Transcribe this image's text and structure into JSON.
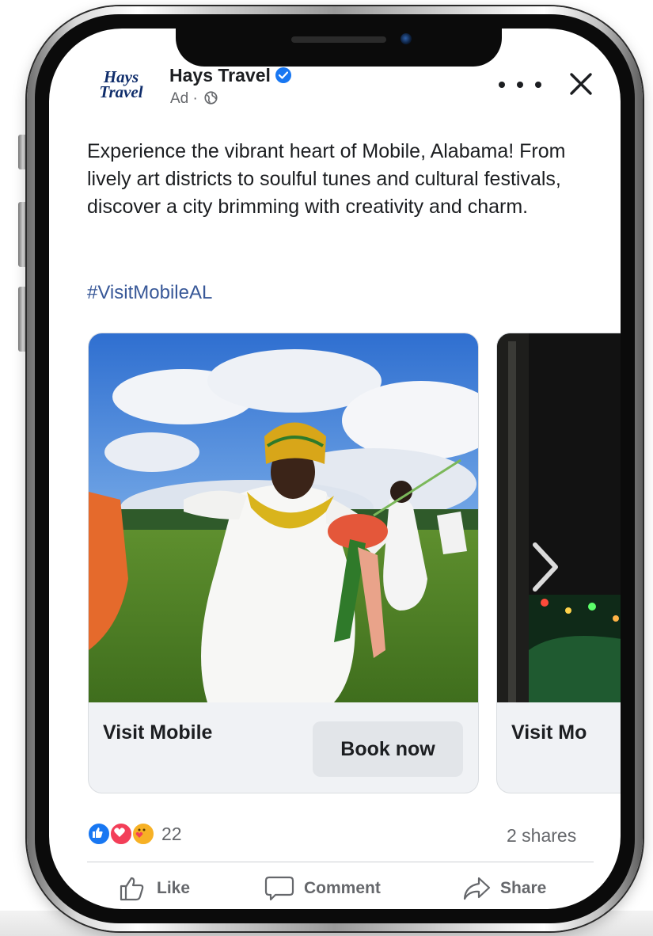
{
  "post": {
    "logo_line1": "Hays",
    "logo_line2": "Travel",
    "page_name": "Hays Travel",
    "sponsored_label": "Ad ·",
    "caption": "Experience the vibrant heart of Mobile, Alabama! From lively art districts to soulful tunes and cultural festivals, discover a city brimming with creativity and charm.",
    "hashtag": "#VisitMobileAL"
  },
  "carousel": {
    "cards": [
      {
        "title": "Visit Mobile",
        "cta": "Book now"
      },
      {
        "title": "Visit Mo"
      }
    ]
  },
  "engagement": {
    "reaction_count": "22",
    "shares": "2 shares"
  },
  "actions": {
    "like": "Like",
    "comment": "Comment",
    "share": "Share"
  },
  "colors": {
    "accent_blue": "#1877f2",
    "link_blue": "#385898",
    "text": "#1c1e21",
    "secondary_text": "#65676b",
    "love_red": "#f33e58",
    "care_yellow": "#f7b125"
  },
  "icons": [
    "verified-badge-icon",
    "globe-icon",
    "more-icon",
    "close-icon",
    "chevron-right-icon",
    "like-reaction-icon",
    "love-reaction-icon",
    "care-reaction-icon",
    "thumbs-up-icon",
    "comment-icon",
    "share-icon"
  ]
}
